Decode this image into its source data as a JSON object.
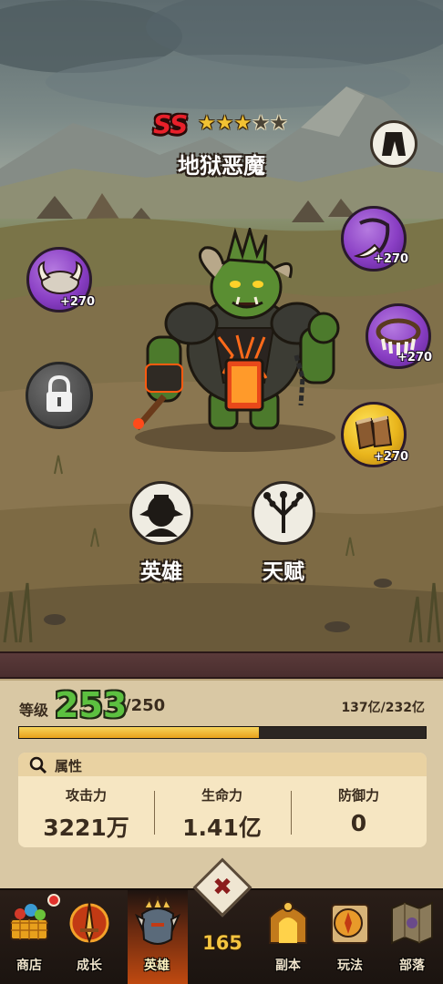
{
  "hero": {
    "grade": "SS",
    "stars_filled": 3,
    "stars_total": 5,
    "name": "地狱恶魔"
  },
  "equipment": [
    {
      "name": "horned-helmet",
      "bonus": "+270",
      "rarity": "purple"
    },
    {
      "name": "fang-necklace",
      "bonus": "+270",
      "rarity": "purple"
    },
    {
      "name": "claw-collar",
      "bonus": "+270",
      "rarity": "purple"
    },
    {
      "name": "fur-boots",
      "bonus": "+270",
      "rarity": "gold"
    }
  ],
  "buttons": {
    "hero": "英雄",
    "talent": "天赋"
  },
  "level": {
    "label": "等级",
    "current": "253",
    "max": "/250",
    "exp": "137亿/232亿",
    "exp_progress": 0.59
  },
  "attributes": {
    "title": "属性",
    "items": [
      {
        "name": "攻击力",
        "value": "3221万"
      },
      {
        "name": "生命力",
        "value": "1.41亿"
      },
      {
        "name": "防御力",
        "value": "0"
      }
    ]
  },
  "nav": {
    "items": [
      {
        "label": "商店",
        "icon": "shop-basket-icon",
        "badge": true
      },
      {
        "label": "成长",
        "icon": "growth-sword-icon"
      },
      {
        "label": "英雄",
        "icon": "hero-helmet-icon",
        "active": true
      },
      {
        "label": "副本",
        "icon": "dungeon-gate-icon"
      },
      {
        "label": "玩法",
        "icon": "compass-icon"
      },
      {
        "label": "部落",
        "icon": "tribe-map-icon"
      }
    ],
    "center_count": "165"
  },
  "colors": {
    "grade_red": "#e8202a",
    "level_green": "#5cc040",
    "purple_rarity": "#8a3fc4",
    "gold_rarity": "#e9b51c"
  }
}
